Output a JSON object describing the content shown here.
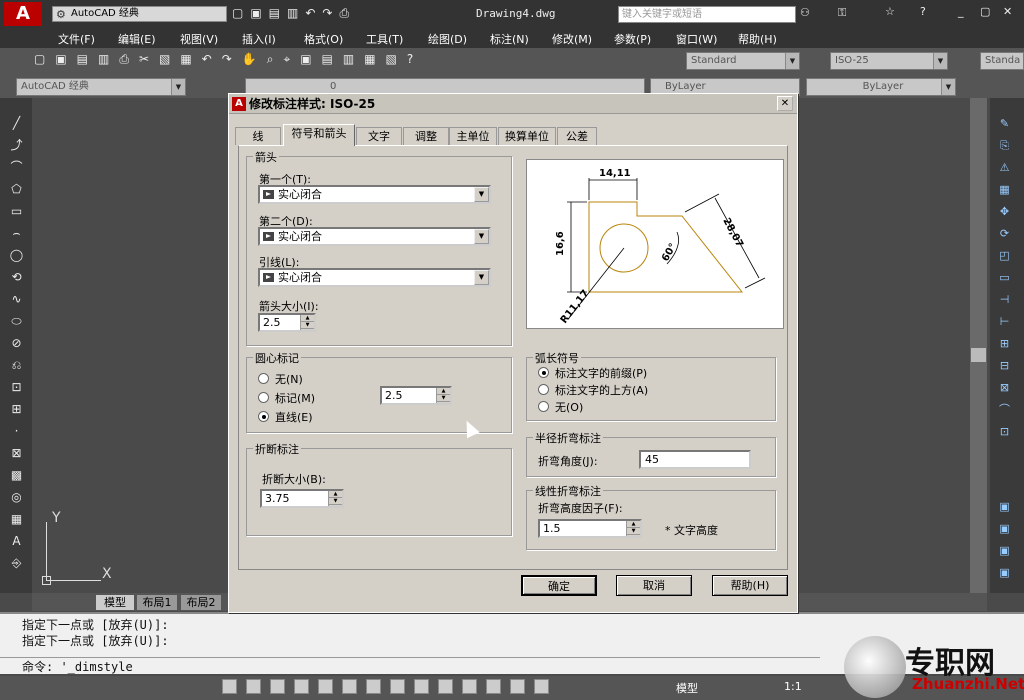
{
  "app": {
    "title": "Drawing4.dwg",
    "workspace": "AutoCAD 经典",
    "search_placeholder": "键入关键字或短语"
  },
  "menu": [
    "文件(F)",
    "编辑(E)",
    "视图(V)",
    "插入(I)",
    "格式(O)",
    "工具(T)",
    "绘图(D)",
    "标注(N)",
    "修改(M)",
    "参数(P)",
    "窗口(W)",
    "帮助(H)"
  ],
  "toolbar": {
    "workspace_combo": "AutoCAD 经典",
    "text_style": "Standard",
    "dim_style": "ISO-25",
    "table_style": "Standa",
    "layer": "0",
    "color": "ByLayer",
    "linetype": "ByLayer"
  },
  "dialog": {
    "title": "修改标注样式: ISO-25",
    "tabs": [
      "线",
      "符号和箭头",
      "文字",
      "调整",
      "主单位",
      "换算单位",
      "公差"
    ],
    "active_tab": "符号和箭头",
    "arrows": {
      "group": "箭头",
      "first_label": "第一个(T):",
      "first_value": "实心闭合",
      "second_label": "第二个(D):",
      "second_value": "实心闭合",
      "leader_label": "引线(L):",
      "leader_value": "实心闭合",
      "size_label": "箭头大小(I):",
      "size_value": "2.5"
    },
    "center_marks": {
      "group": "圆心标记",
      "options": [
        "无(N)",
        "标记(M)",
        "直线(E)"
      ],
      "selected": "直线(E)",
      "value": "2.5"
    },
    "break": {
      "group": "折断标注",
      "label": "折断大小(B):",
      "value": "3.75"
    },
    "arc_length": {
      "group": "弧长符号",
      "options": [
        "标注文字的前缀(P)",
        "标注文字的上方(A)",
        "无(O)"
      ],
      "selected": "标注文字的前缀(P)"
    },
    "radius_jog": {
      "group": "半径折弯标注",
      "label": "折弯角度(J):",
      "value": "45"
    },
    "linear_jog": {
      "group": "线性折弯标注",
      "label": "折弯高度因子(F):",
      "value": "1.5",
      "unit": "* 文字高度"
    },
    "preview": {
      "dim1": "14,11",
      "dim2": "16,6",
      "dim3": "28,07",
      "angle": "60°",
      "radius": "R11,17"
    },
    "buttons": {
      "ok": "确定",
      "cancel": "取消",
      "help": "帮助(H)"
    }
  },
  "layout_tabs": [
    "模型",
    "布局1",
    "布局2"
  ],
  "command": {
    "line1": "指定下一点或 [放弃(U)]:",
    "line2": "指定下一点或 [放弃(U)]:",
    "prompt": "命令: '_dimstyle"
  },
  "status": {
    "model": "模型",
    "scale": "1:1"
  },
  "watermark": {
    "cn": "专职网",
    "url": "Zhuanzhi.Net"
  },
  "axis": {
    "y": "Y",
    "x": "X"
  }
}
